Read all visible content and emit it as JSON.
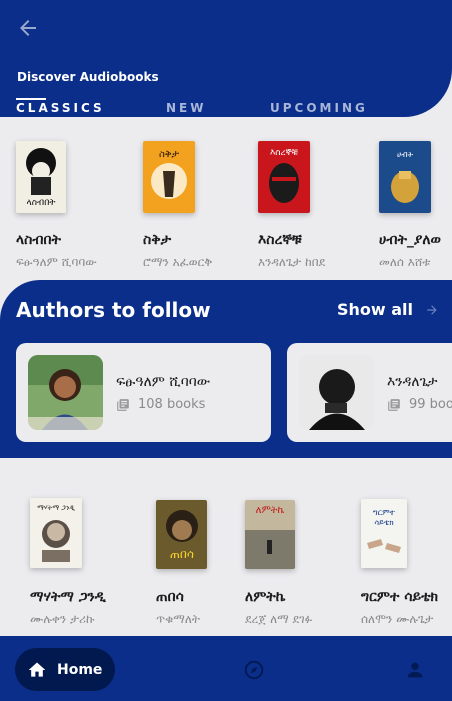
{
  "header": {
    "section_title": "Discover Audiobooks",
    "tabs": [
      {
        "label": "CLASSICS",
        "active": true
      },
      {
        "label": "NEW",
        "active": false
      },
      {
        "label": "UPCOMING",
        "active": false
      }
    ]
  },
  "row1": [
    {
      "title": "ላስብበት",
      "author": "ፍፁዓለም ሺባባው"
    },
    {
      "title": "ስቅታ",
      "author": "ሮማን አፈወርቅ"
    },
    {
      "title": "እስረኞቹ",
      "author": "እንዳለጌታ ከበደ"
    },
    {
      "title": "ሀብት_ያለወ",
      "author": "መለሰ እሸቱ"
    }
  ],
  "authors": {
    "title": "Authors to follow",
    "show_all": "Show all",
    "items": [
      {
        "name": "ፍፁዓለም ሺባባው",
        "count": "108 books"
      },
      {
        "name": "እንዳለጌታ",
        "count": "99 boo"
      }
    ]
  },
  "row2": [
    {
      "title": "ማሃትማ ጋንዲ",
      "author": "ሙሉቀን ታሪኩ"
    },
    {
      "title": "ጠበሳ",
      "author": "ጥቁማለት"
    },
    {
      "title": "ለምትኬ",
      "author": "ደረጀ ለማ ደገፉ"
    },
    {
      "title": "ግርምተ ሳይቴክ",
      "author": "ሰለሞን ሙሉጌታ"
    }
  ],
  "nav": {
    "home_label": "Home"
  },
  "colors": {
    "primary": "#0a2e8a",
    "primary_dark": "#02194f",
    "background": "#ececef"
  }
}
